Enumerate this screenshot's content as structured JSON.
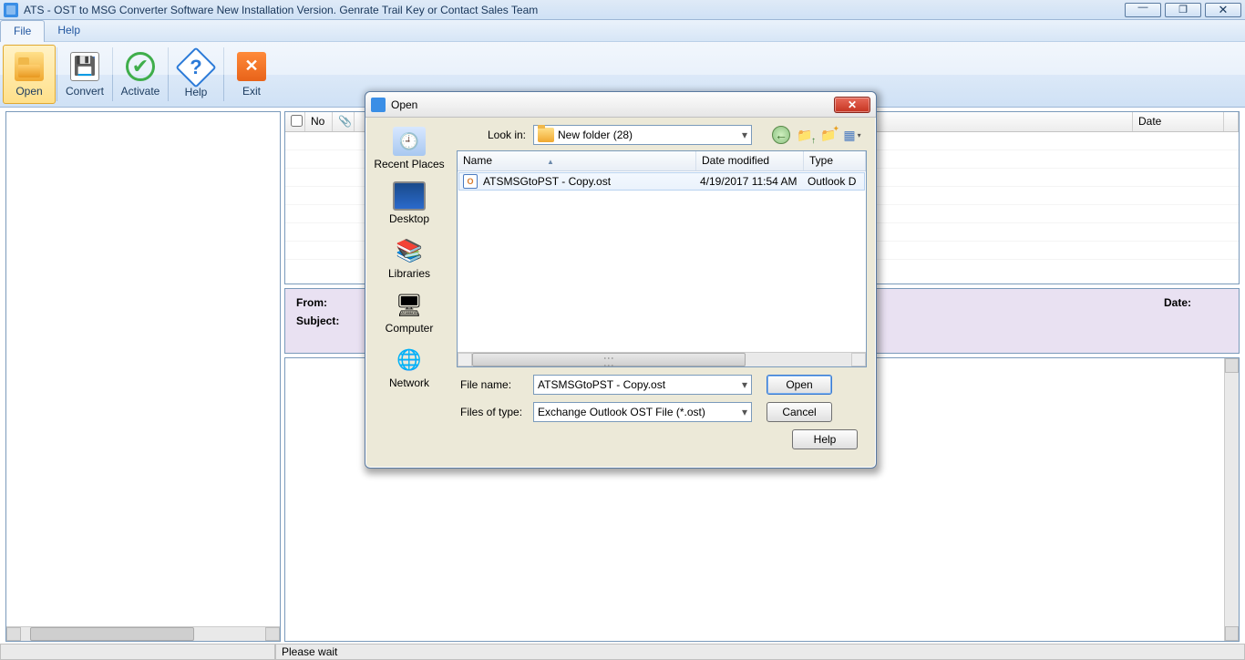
{
  "window": {
    "title": "ATS - OST to MSG Converter Software New Installation Version. Genrate Trail Key or Contact Sales Team"
  },
  "menu": {
    "file": "File",
    "help": "Help"
  },
  "toolbar": {
    "open": "Open",
    "convert": "Convert",
    "activate": "Activate",
    "help": "Help",
    "exit": "Exit"
  },
  "grid": {
    "col_no": "No",
    "col_date": "Date"
  },
  "detail": {
    "from": "From:",
    "subject": "Subject:",
    "date": "Date:"
  },
  "status": {
    "msg": "Please wait"
  },
  "dialog": {
    "title": "Open",
    "lookin_label": "Look in:",
    "lookin_value": "New folder (28)",
    "places": {
      "recent": "Recent Places",
      "desktop": "Desktop",
      "libraries": "Libraries",
      "computer": "Computer",
      "network": "Network"
    },
    "columns": {
      "name": "Name",
      "date": "Date modified",
      "type": "Type"
    },
    "file": {
      "name": "ATSMSGtoPST - Copy.ost",
      "date": "4/19/2017 11:54 AM",
      "type": "Outlook D"
    },
    "filename_label": "File name:",
    "filename_value": "ATSMSGtoPST - Copy.ost",
    "filetype_label": "Files of type:",
    "filetype_value": "Exchange Outlook OST File (*.ost)",
    "btn_open": "Open",
    "btn_cancel": "Cancel",
    "btn_help": "Help"
  }
}
